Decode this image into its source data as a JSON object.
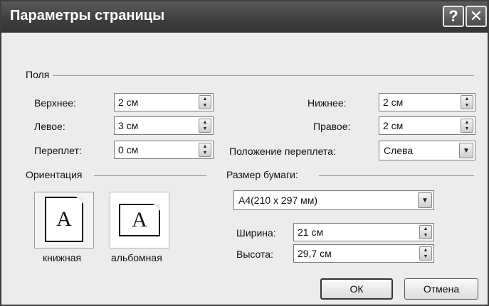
{
  "window": {
    "title": "Параметры страницы"
  },
  "titlebar": {
    "help_label": "?",
    "close_label": "✕"
  },
  "margins": {
    "group_label": "Поля",
    "top": {
      "label": "Верхнее:",
      "value": "2 см"
    },
    "left": {
      "label": "Левое:",
      "value": "3 см"
    },
    "gutter": {
      "label_pre": "Переплет",
      "label_post": ":",
      "mnemonic": "",
      "value": "0 см"
    },
    "bottom": {
      "label": "Нижнее:",
      "value": "2 см"
    },
    "right": {
      "label": "Правое:",
      "value": "2 см"
    },
    "gutter_position": {
      "label": "Положение переплета:",
      "value": "Слева"
    }
  },
  "orientation": {
    "group_label": "Ориентация",
    "portrait": {
      "label": "книжная",
      "glyph": "A",
      "selected": true
    },
    "landscape": {
      "label": "альбомная",
      "glyph": "A",
      "selected": false
    }
  },
  "paper": {
    "group_label": "Размер бумаги:",
    "size_value": "А4(210 x 297 мм)",
    "width": {
      "label": "Ширина:",
      "value": "21 см"
    },
    "height": {
      "label": "Высота:",
      "value": "29,7 см"
    }
  },
  "buttons": {
    "ok": "ОК",
    "cancel": "Отмена"
  },
  "icons": {
    "spin": "spin-arrows-icon",
    "dropdown": "chevron-down-icon",
    "help": "help-icon",
    "close": "close-icon"
  }
}
